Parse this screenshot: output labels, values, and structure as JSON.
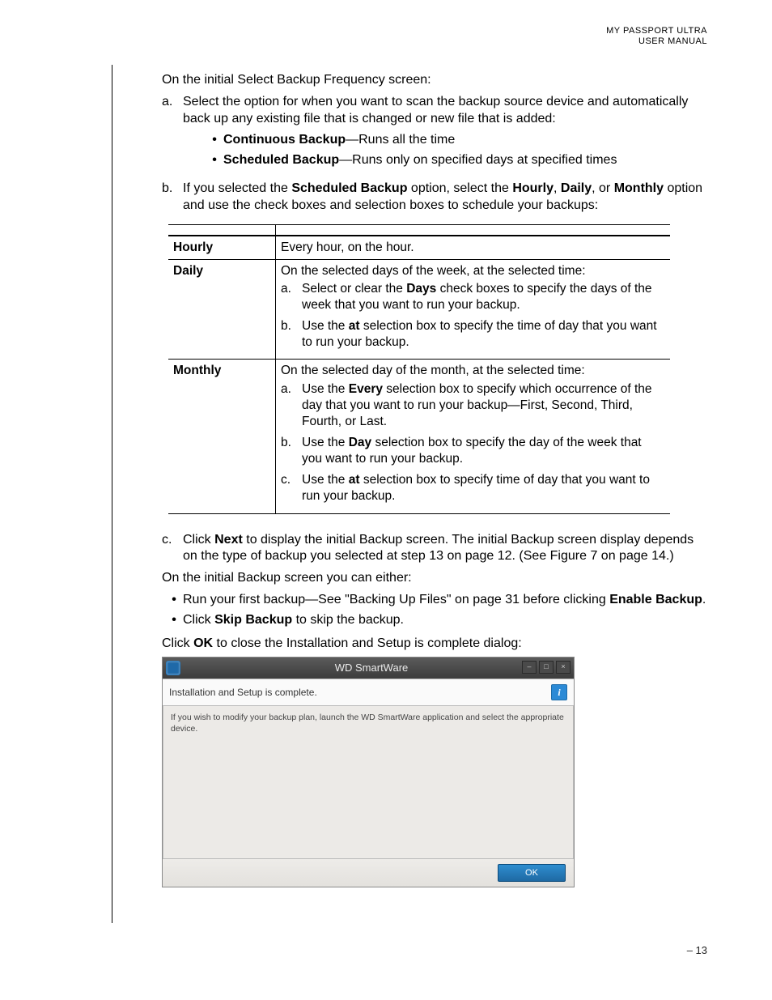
{
  "header": {
    "line1": "MY PASSPORT ULTRA",
    "line2": "USER MANUAL"
  },
  "intro": "On the initial Select Backup Frequency screen:",
  "step_a": {
    "marker": "a.",
    "text": "Select the option for when you want to scan the backup source device and automatically back up any existing file that is changed or new file that is added:",
    "bullets": [
      {
        "bold": "Continuous Backup",
        "rest": "—Runs all the time"
      },
      {
        "bold": "Scheduled Backup",
        "rest": "—Runs only on specified days at specified times"
      }
    ]
  },
  "step_b": {
    "marker": "b.",
    "pre": "If you selected the ",
    "b1": "Scheduled Backup",
    "mid1": " option, select the ",
    "b2": "Hourly",
    "sep": ", ",
    "b3": "Daily",
    "mid2": ", or ",
    "b4": "Monthly",
    "post": " option and use the check boxes and selection boxes to schedule your backups:"
  },
  "table": {
    "hourly": {
      "label": "Hourly",
      "text": "Every hour, on the hour."
    },
    "daily": {
      "label": "Daily",
      "intro": "On the selected days of the week, at the selected time:",
      "a": {
        "m": "a.",
        "pre": "Select or clear the ",
        "b": "Days",
        "post": " check boxes to specify the days of the week that you want to run your backup."
      },
      "b": {
        "m": "b.",
        "pre": "Use the ",
        "b": "at",
        "post": " selection box to specify the time of day that you want to run your backup."
      }
    },
    "monthly": {
      "label": "Monthly",
      "intro": "On the selected day of the month, at the selected time:",
      "a": {
        "m": "a.",
        "pre": "Use the ",
        "b": "Every",
        "post": " selection box to specify which occurrence of the day that you want to run your backup—First, Second, Third, Fourth, or Last."
      },
      "b": {
        "m": "b.",
        "pre": "Use the ",
        "b": "Day",
        "post": " selection box to specify the day of the week that you want to run your backup."
      },
      "c": {
        "m": "c.",
        "pre": "Use the ",
        "b": "at",
        "post": " selection box to specify time of day that you want to run your backup."
      }
    }
  },
  "step_c": {
    "marker": "c.",
    "pre": "Click ",
    "b1": "Next",
    "post": " to display the initial Backup screen. The initial Backup screen display depends on the type of backup you selected at step 13 on page 12. (See Figure 7 on page 14.)"
  },
  "para2": "On the initial Backup screen you can either:",
  "options": [
    {
      "pre": "Run your first backup—See \"Backing Up Files\" on page 31 before clicking ",
      "b": "Enable Backup",
      "post": "."
    },
    {
      "pre": "Click ",
      "b": "Skip Backup",
      "post": " to skip the backup."
    }
  ],
  "para3": {
    "pre": "Click ",
    "b": "OK",
    "post": " to close the Installation and Setup is complete dialog:"
  },
  "dialog": {
    "title": "WD SmartWare",
    "message": "Installation and Setup is complete.",
    "body": "If you wish to modify your backup plan, launch the WD SmartWare application and select the appropriate device.",
    "ok": "OK",
    "info_glyph": "i"
  },
  "page_number": "– 13"
}
